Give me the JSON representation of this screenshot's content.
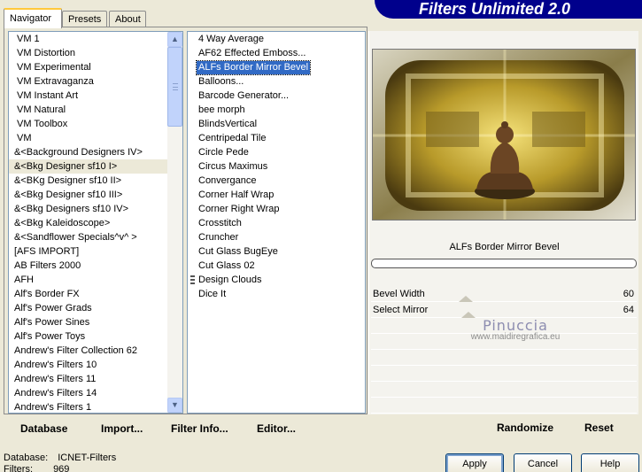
{
  "tabs": [
    "Navigator",
    "Presets",
    "About"
  ],
  "banner": "Filters Unlimited 2.0",
  "categories": [
    "VM 1",
    "VM Distortion",
    "VM Experimental",
    "VM Extravaganza",
    "VM Instant Art",
    "VM Natural",
    "VM Toolbox",
    "VM",
    "&<Background Designers IV>",
    "&<Bkg Designer sf10 I>",
    "&<BKg Designer sf10 II>",
    "&<Bkg Designer sf10 III>",
    "&<Bkg Designers sf10 IV>",
    "&<Bkg Kaleidoscope>",
    "&<Sandflower Specials^v^ >",
    "[AFS IMPORT]",
    "AB Filters 2000",
    "AFH",
    "Alf's Border FX",
    "Alf's Power Grads",
    "Alf's Power Sines",
    "Alf's Power Toys",
    "Andrew's Filter Collection 62",
    "Andrew's Filters 10",
    "Andrew's Filters 11",
    "Andrew's Filters 14",
    "Andrew's Filters 1"
  ],
  "selected_category_index": 9,
  "filters": [
    "4 Way Average",
    "AF62 Effected Emboss...",
    "ALFs Border Mirror Bevel",
    "Balloons...",
    "Barcode Generator...",
    "bee morph",
    "BlindsVertical",
    "Centripedal Tile",
    "Circle Pede",
    "Circus Maximus",
    "Convergance",
    "Corner Half Wrap",
    "Corner Right Wrap",
    "Crosstitch",
    "Cruncher",
    "Cut Glass  BugEye",
    "Cut Glass 02",
    "Design Clouds",
    "Dice It"
  ],
  "selected_filter_index": 2,
  "marked_filter_index": 17,
  "left_buttons": {
    "database": "Database",
    "import": "Import...",
    "filter_info": "Filter Info...",
    "editor": "Editor..."
  },
  "filter_title": "ALFs Border Mirror Bevel",
  "params": [
    {
      "label": "Bevel Width",
      "value": "60",
      "level": 0.235
    },
    {
      "label": "Select Mirror",
      "value": "64",
      "level": 0.25
    }
  ],
  "watermark": {
    "name": "Pinuccia",
    "site": "www.maidiregrafica.eu"
  },
  "right_buttons": {
    "randomize": "Randomize",
    "reset": "Reset"
  },
  "status": {
    "database_label": "Database:",
    "database_value": "ICNET-Filters",
    "filters_label": "Filters:",
    "filters_value": "969"
  },
  "dialog_buttons": {
    "apply": "Apply",
    "cancel": "Cancel",
    "help": "Help"
  }
}
